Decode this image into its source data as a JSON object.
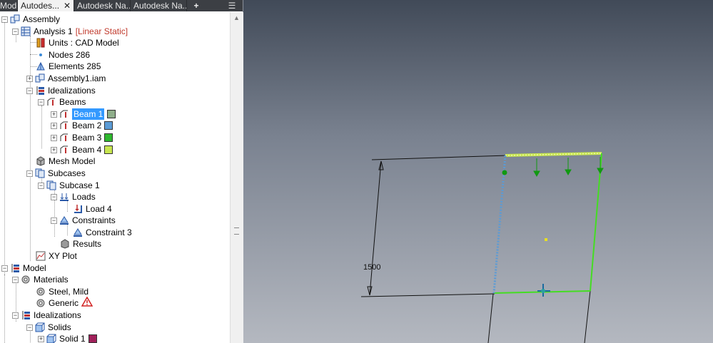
{
  "tabs": [
    {
      "label": "Model",
      "close": ""
    },
    {
      "label": "Autodes...",
      "close": "✕"
    },
    {
      "label": "Autodesk Na..."
    },
    {
      "label": "Autodesk Na..."
    }
  ],
  "tab_add": "+",
  "tab_menu": "☰",
  "tree": {
    "assembly": "Assembly",
    "analysis": "Analysis 1",
    "analysis_type": "[Linear Static]",
    "units": "Units : CAD Model",
    "nodes": "Nodes 286",
    "elements": "Elements 285",
    "assembly_iam": "Assembly1.iam",
    "idealizations": "Idealizations",
    "beams": "Beams",
    "beam_items": [
      {
        "label": "Beam 1",
        "color": "#8fae8a"
      },
      {
        "label": "Beam 2",
        "color": "#5b9bd5"
      },
      {
        "label": "Beam 3",
        "color": "#2eb82e"
      },
      {
        "label": "Beam 4",
        "color": "#c8e650"
      }
    ],
    "mesh_model": "Mesh Model",
    "subcases": "Subcases",
    "subcase1": "Subcase 1",
    "loads": "Loads",
    "load4": "Load 4",
    "constraints": "Constraints",
    "constraint3": "Constraint 3",
    "results": "Results",
    "xy_plot": "XY Plot",
    "model": "Model",
    "materials": "Materials",
    "steel": "Steel, Mild",
    "generic": "Generic",
    "idealizations2": "Idealizations",
    "solids": "Solids",
    "solid1": "Solid 1",
    "solid1_color": "#a0205a"
  },
  "viewport": {
    "dimension_label": "1500",
    "beam_color_top": "#c8e650",
    "beam_color_right": "#2eb82e",
    "beam_color_left": "#5b9bd5"
  }
}
